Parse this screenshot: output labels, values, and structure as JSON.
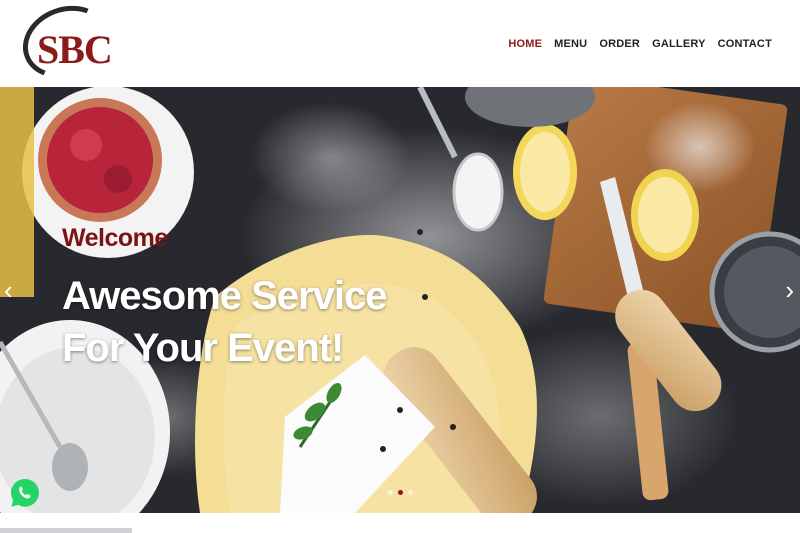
{
  "brand": {
    "logo_text": "SBC"
  },
  "nav": {
    "items": [
      {
        "label": "HOME",
        "active": true
      },
      {
        "label": "MENU",
        "active": false
      },
      {
        "label": "ORDER",
        "active": false
      },
      {
        "label": "GALLERY",
        "active": false
      },
      {
        "label": "CONTACT",
        "active": false
      }
    ]
  },
  "hero": {
    "welcome": "Welcome",
    "headline_line1": "Awesome Service",
    "headline_line2": "For Your Event!",
    "prev_icon": "chevron-left-icon",
    "next_icon": "chevron-right-icon",
    "slides_count": 3,
    "active_slide": 2
  },
  "whatsapp": {
    "icon": "whatsapp-icon",
    "color": "#25d366"
  },
  "colors": {
    "accent": "#8b1a1a",
    "nav_text": "#222222"
  }
}
